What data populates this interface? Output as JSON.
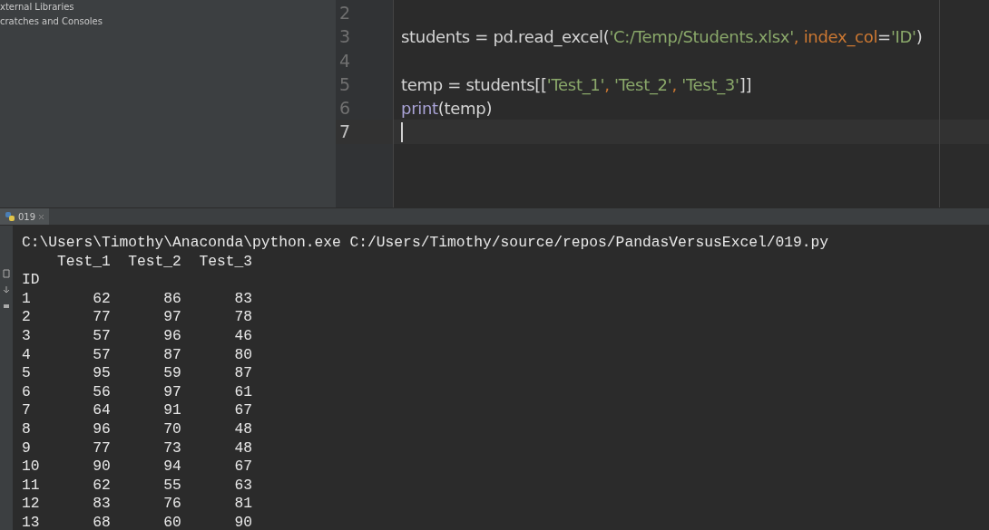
{
  "project_tree": {
    "items": [
      {
        "label": "xternal Libraries"
      },
      {
        "label": "cratches and Consoles"
      }
    ]
  },
  "editor": {
    "lines": [
      {
        "number": "2",
        "current": false
      },
      {
        "number": "3",
        "current": false,
        "tokens": [
          {
            "text": "students = pd.read_excel(",
            "kind": "plain"
          },
          {
            "text": "'C:/Temp/Students.xlsx'",
            "kind": "string"
          },
          {
            "text": ", ",
            "kind": "keyword"
          },
          {
            "text": "index_col",
            "kind": "keyword"
          },
          {
            "text": "=",
            "kind": "plain"
          },
          {
            "text": "'ID'",
            "kind": "string"
          },
          {
            "text": ")",
            "kind": "plain"
          }
        ]
      },
      {
        "number": "4",
        "current": false
      },
      {
        "number": "5",
        "current": false,
        "tokens": [
          {
            "text": "temp = students[[",
            "kind": "plain"
          },
          {
            "text": "'Test_1'",
            "kind": "string"
          },
          {
            "text": ", ",
            "kind": "keyword"
          },
          {
            "text": "'Test_2'",
            "kind": "string"
          },
          {
            "text": ", ",
            "kind": "keyword"
          },
          {
            "text": "'Test_3'",
            "kind": "string"
          },
          {
            "text": "]]",
            "kind": "plain"
          }
        ]
      },
      {
        "number": "6",
        "current": false,
        "tokens": [
          {
            "text": "print",
            "kind": "builtin"
          },
          {
            "text": "(temp)",
            "kind": "plain"
          }
        ]
      },
      {
        "number": "7",
        "current": true
      }
    ]
  },
  "run_tab": {
    "label": "019",
    "selected": true
  },
  "console": {
    "lines": [
      "C:\\Users\\Timothy\\Anaconda\\python.exe C:/Users/Timothy/source/repos/PandasVersusExcel/019.py",
      "    Test_1  Test_2  Test_3",
      "ID",
      "1       62      86      83",
      "2       77      97      78",
      "3       57      96      46",
      "4       57      87      80",
      "5       95      59      87",
      "6       56      97      61",
      "7       64      91      67",
      "8       96      70      48",
      "9       77      73      48",
      "10      90      94      67",
      "11      62      55      63",
      "12      83      76      81",
      "13      68      60      90"
    ]
  }
}
